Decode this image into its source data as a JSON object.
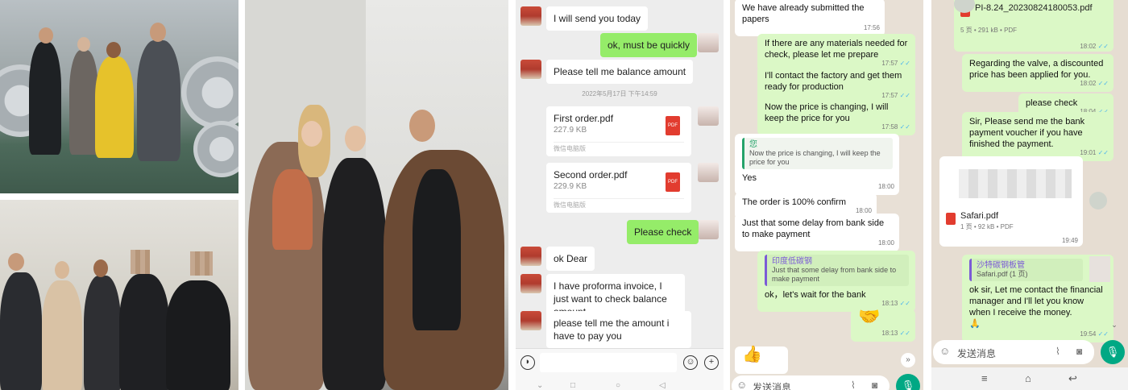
{
  "wechat": {
    "messages": [
      {
        "text": "I will send you today"
      },
      {
        "text": "ok, must be quickly"
      },
      {
        "text": "Please tell me balance amount"
      }
    ],
    "timestamp": "2022年5月17日 下午14:59",
    "files": [
      {
        "name": "First order.pdf",
        "size": "227.9 KB",
        "source": "微信电脑版",
        "badge": "PDF"
      },
      {
        "name": "Second order.pdf",
        "size": "229.9 KB",
        "source": "微信电脑版",
        "badge": "PDF"
      }
    ],
    "messages2": [
      {
        "text": "Please check"
      },
      {
        "text": "ok Dear"
      },
      {
        "text": "I have proforma invoice, I just want to check balance amount"
      },
      {
        "text": "please tell me the amount i have to pay you"
      }
    ]
  },
  "whatsapp1": {
    "m1": {
      "text": "We have already submitted the papers",
      "time": "17:56"
    },
    "m2": {
      "text": "If there are any materials needed for check, please let me prepare",
      "time": "17:57"
    },
    "m3": {
      "text": "I'll contact the factory and get them ready for production",
      "time": "17:57"
    },
    "m4": {
      "text": "Now the price is changing, I will keep the  price for you",
      "time": "17:58"
    },
    "m5": {
      "quote_name": "您",
      "quote_text": "Now the price is changing, I will keep the price for you",
      "text": "Yes",
      "time": "18:00"
    },
    "m6": {
      "text": "The order is 100% confirm",
      "time": "18:00"
    },
    "m7": {
      "text": "Just that some delay from bank side to make payment",
      "time": "18:00"
    },
    "m8": {
      "quote_name": "印度低碳钢",
      "quote_text": "Just that some delay from bank side to make payment",
      "text": "ok，let's wait for the bank",
      "time": "18:13"
    },
    "m9": {
      "emoji": "🤝",
      "time": "18:13"
    },
    "m10": {
      "emoji": "👍"
    },
    "placeholder": "发送消息",
    "check": "✓✓"
  },
  "whatsapp2": {
    "file1": {
      "name": "PI-8.24_20230824180053.pdf",
      "meta": "5 页 • 291 kB • PDF",
      "time": "18:02"
    },
    "m1": {
      "text": "Regarding the valve, a discounted price has been applied for you.",
      "time": "18:02"
    },
    "m2": {
      "text": "please check",
      "time": "18:04"
    },
    "m3": {
      "text": "Sir, Please send me the bank payment voucher if you have finished the payment.",
      "time": "19:01"
    },
    "file2": {
      "name": "Safari.pdf",
      "meta": "1 页 • 92 kB • PDF",
      "time": "19:49"
    },
    "m4": {
      "quote_name": "沙特碳钢板管",
      "quote_text": "Safari.pdf (1 页)",
      "text": "ok sir, Let me contact the financial manager and I'll let you know when I receive the money.",
      "emoji": "🙏",
      "time": "19:54"
    },
    "placeholder": "发送消息",
    "check": "✓✓"
  }
}
